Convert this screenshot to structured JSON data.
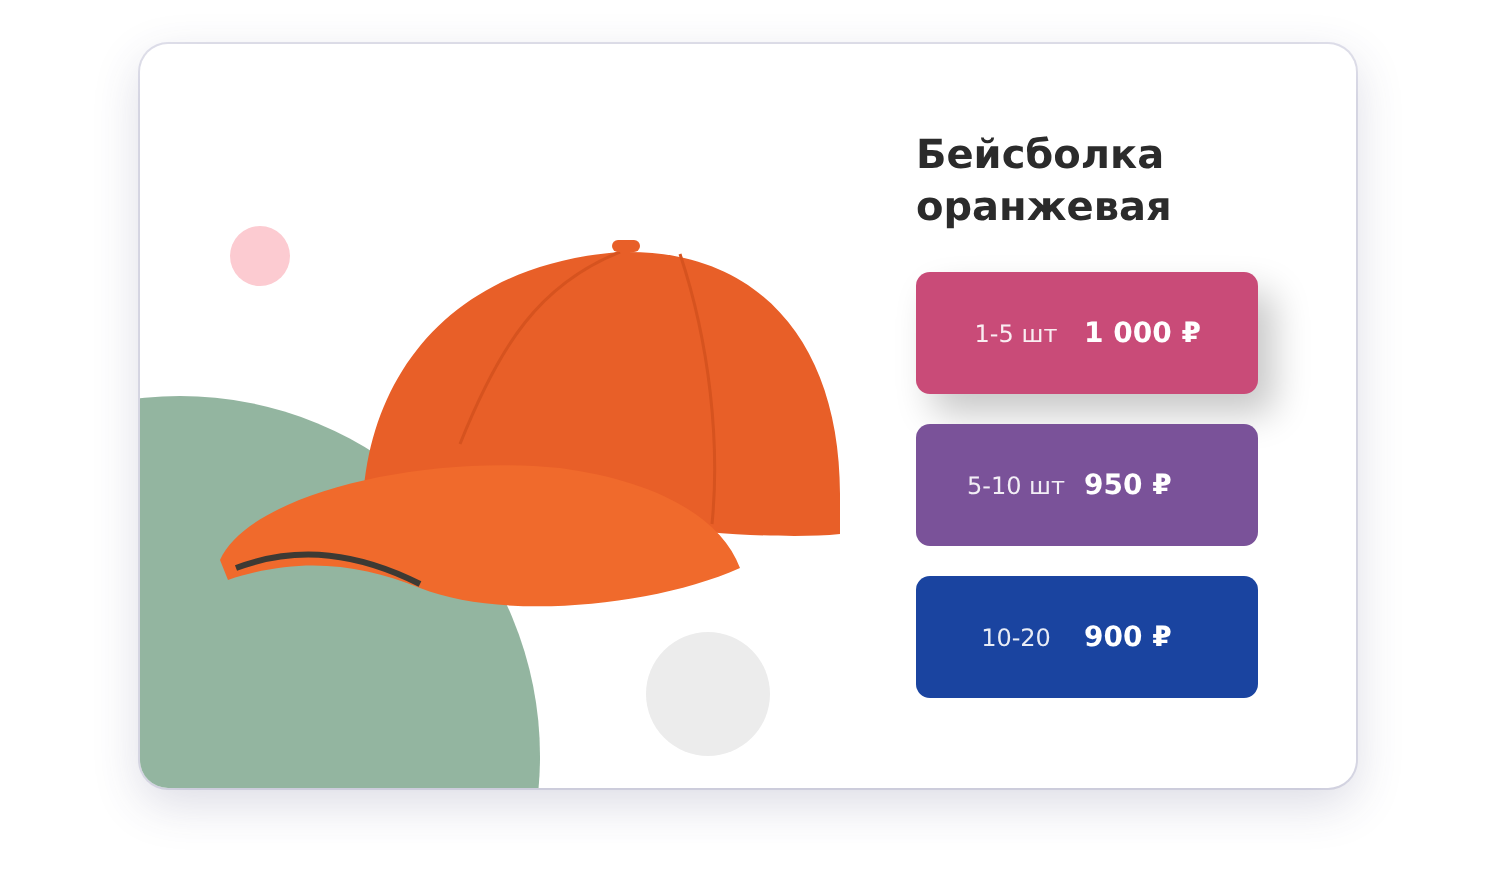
{
  "product": {
    "title": "Бейсболка оранжевая"
  },
  "price_tiers": [
    {
      "range": "1-5 шт",
      "price": "1 000 ₽",
      "color": "#c94b78",
      "selected": true
    },
    {
      "range": "5-10 шт",
      "price": "950 ₽",
      "color": "#7a5299",
      "selected": false
    },
    {
      "range": "10-20",
      "price": "900 ₽",
      "color": "#1a44a0",
      "selected": false
    }
  ]
}
